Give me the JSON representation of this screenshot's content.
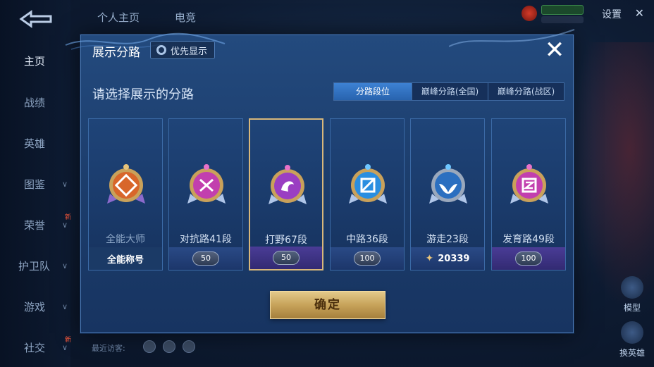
{
  "sidebar": {
    "items": [
      {
        "label": "主页",
        "chevron": false,
        "badge": ""
      },
      {
        "label": "战绩",
        "chevron": false,
        "badge": ""
      },
      {
        "label": "英雄",
        "chevron": false,
        "badge": ""
      },
      {
        "label": "图鉴",
        "chevron": true,
        "badge": ""
      },
      {
        "label": "荣誉",
        "chevron": true,
        "badge": "新"
      },
      {
        "label": "护卫队",
        "chevron": true,
        "badge": ""
      },
      {
        "label": "游戏",
        "chevron": true,
        "badge": ""
      },
      {
        "label": "社交",
        "chevron": true,
        "badge": "新"
      }
    ]
  },
  "topbar": {
    "tabs": [
      "个人主页",
      "电竞"
    ],
    "settings_label": "设置"
  },
  "right_buttons": [
    "模型",
    "换英雄"
  ],
  "recent_label": "最近访客:",
  "modal": {
    "title": "展示分路",
    "priority_label": "优先显示",
    "prompt": "请选择展示的分路",
    "segments": [
      "分路段位",
      "巅峰分路(全国)",
      "巅峰分路(战区)"
    ],
    "cards": [
      {
        "name": "全能大师",
        "footer_type": "text",
        "footer": "全能称号",
        "medal": "orange",
        "selected": false
      },
      {
        "name": "对抗路41段",
        "footer_type": "rank",
        "footer": "50",
        "medal": "pink",
        "selected": false
      },
      {
        "name": "打野67段",
        "footer_type": "rank",
        "footer": "50",
        "medal": "purple",
        "selected": true
      },
      {
        "name": "中路36段",
        "footer_type": "rank",
        "footer": "100",
        "medal": "blue",
        "selected": false
      },
      {
        "name": "游走23段",
        "footer_type": "points",
        "footer": "20339",
        "medal": "teal",
        "selected": false
      },
      {
        "name": "发育路49段",
        "footer_type": "rank",
        "footer": "100",
        "medal": "magenta",
        "selected": false
      }
    ],
    "confirm_label": "确定"
  },
  "colors": {
    "accent_blue": "#2863ae",
    "gold": "#c7a35a",
    "selected_border": "#d8b77a"
  }
}
